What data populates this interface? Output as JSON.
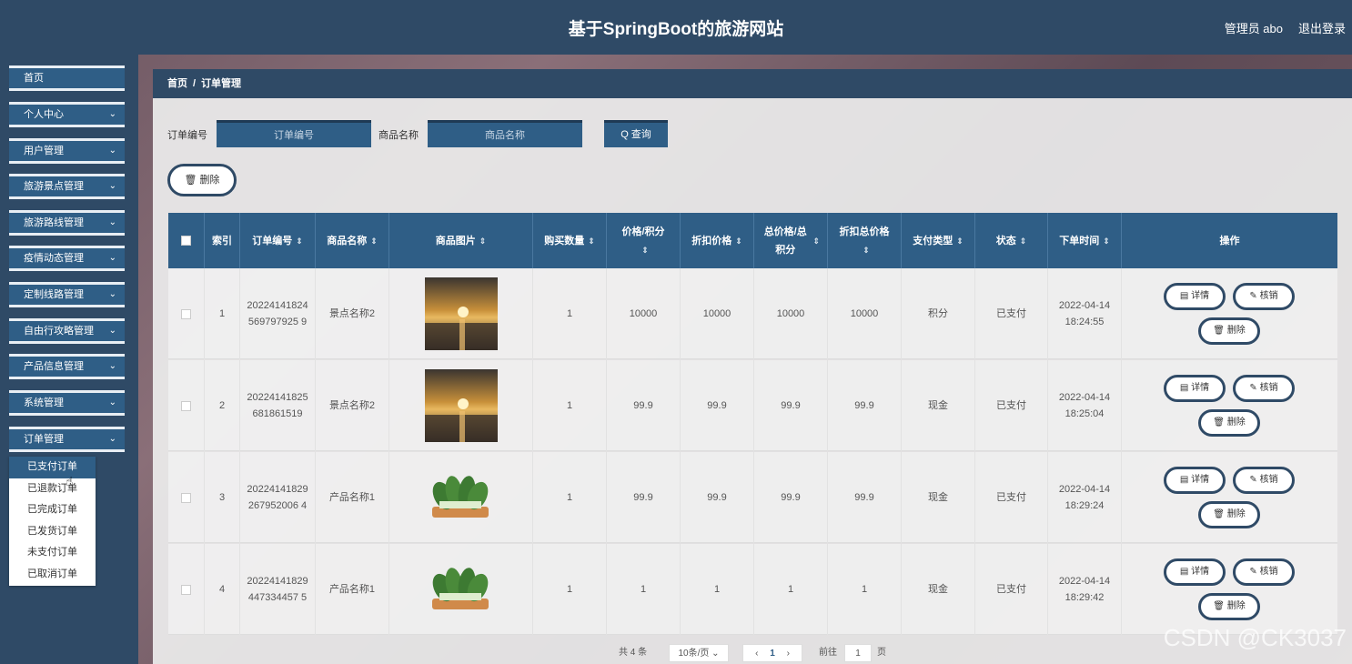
{
  "header": {
    "title": "基于SpringBoot的旅游网站",
    "admin": "管理员 abo",
    "logout": "退出登录"
  },
  "sidebar": {
    "items": [
      {
        "label": "首页",
        "chevron": ""
      },
      {
        "label": "个人中心",
        "chevron": "⌄"
      },
      {
        "label": "用户管理",
        "chevron": "⌄"
      },
      {
        "label": "旅游景点管理",
        "chevron": "⌄"
      },
      {
        "label": "旅游路线管理",
        "chevron": "⌄"
      },
      {
        "label": "疫情动态管理",
        "chevron": "⌄"
      },
      {
        "label": "定制线路管理",
        "chevron": "⌄"
      },
      {
        "label": "自由行攻略管理",
        "chevron": "⌄"
      },
      {
        "label": "产品信息管理",
        "chevron": "⌄"
      },
      {
        "label": "系统管理",
        "chevron": "⌄"
      },
      {
        "label": "订单管理",
        "chevron": "⌄"
      }
    ],
    "submenu": [
      "已支付订单",
      "已退款订单",
      "已完成订单",
      "已发货订单",
      "未支付订单",
      "已取消订单"
    ]
  },
  "breadcrumb": {
    "home": "首页",
    "sep": "/",
    "current": "订单管理"
  },
  "search": {
    "order_label": "订单编号",
    "order_placeholder": "订单编号",
    "name_label": "商品名称",
    "name_placeholder": "商品名称",
    "query": "Q 查询"
  },
  "delete_button": "🗑 删除",
  "table": {
    "columns": [
      "索引",
      "订单编号",
      "商品名称",
      "商品图片",
      "购买数量",
      "价格/积分",
      "折扣价格",
      "总价格/总积分",
      "折扣总价格",
      "支付类型",
      "状态",
      "下单时间",
      "操作"
    ],
    "rows": [
      {
        "index": "1",
        "order_no": "20224141824569797925 9",
        "name": "景点名称2",
        "img": "sunset",
        "qty": "1",
        "price": "10000",
        "discount": "10000",
        "total": "10000",
        "discount_total": "10000",
        "pay_type": "积分",
        "status": "已支付",
        "date": "2022-04-14",
        "time": "18:24:55"
      },
      {
        "index": "2",
        "order_no": "20224141825681861519",
        "name": "景点名称2",
        "img": "sunset",
        "qty": "1",
        "price": "99.9",
        "discount": "99.9",
        "total": "99.9",
        "discount_total": "99.9",
        "pay_type": "现金",
        "status": "已支付",
        "date": "2022-04-14",
        "time": "18:25:04"
      },
      {
        "index": "3",
        "order_no": "20224141829267952006 4",
        "name": "产品名称1",
        "img": "vegetable",
        "qty": "1",
        "price": "99.9",
        "discount": "99.9",
        "total": "99.9",
        "discount_total": "99.9",
        "pay_type": "现金",
        "status": "已支付",
        "date": "2022-04-14",
        "time": "18:29:24"
      },
      {
        "index": "4",
        "order_no": "20224141829447334457 5",
        "name": "产品名称1",
        "img": "vegetable",
        "qty": "1",
        "price": "1",
        "discount": "1",
        "total": "1",
        "discount_total": "1",
        "pay_type": "现金",
        "status": "已支付",
        "date": "2022-04-14",
        "time": "18:29:42"
      }
    ],
    "ops": {
      "detail": "详情",
      "verify": "核销",
      "delete": "删除"
    }
  },
  "pager": {
    "total": "共 4 条",
    "page_size": "10条/页",
    "page": "1",
    "goto": "前往",
    "goto_value": "1",
    "unit": "页"
  },
  "watermark": "CSDN @CK3037"
}
